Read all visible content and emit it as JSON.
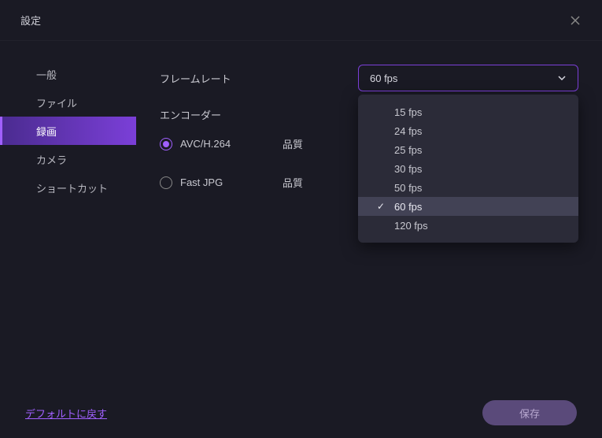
{
  "title": "設定",
  "sidebar": {
    "items": [
      {
        "label": "一般",
        "active": false
      },
      {
        "label": "ファイル",
        "active": false
      },
      {
        "label": "録画",
        "active": true
      },
      {
        "label": "カメラ",
        "active": false
      },
      {
        "label": "ショートカット",
        "active": false
      }
    ]
  },
  "content": {
    "framerate_label": "フレームレート",
    "framerate_value": "60 fps",
    "framerate_options": [
      "15 fps",
      "24 fps",
      "25 fps",
      "30 fps",
      "50 fps",
      "60 fps",
      "120 fps"
    ],
    "encoder_label": "エンコーダー",
    "encoder_options": [
      {
        "label": "AVC/H.264",
        "checked": true
      },
      {
        "label": "Fast JPG",
        "checked": false
      }
    ],
    "quality_label": "品質"
  },
  "footer": {
    "reset_label": "デフォルトに戻す",
    "save_label": "保存"
  },
  "colors": {
    "accent": "#7b3fd8",
    "accent_light": "#a060ff"
  }
}
